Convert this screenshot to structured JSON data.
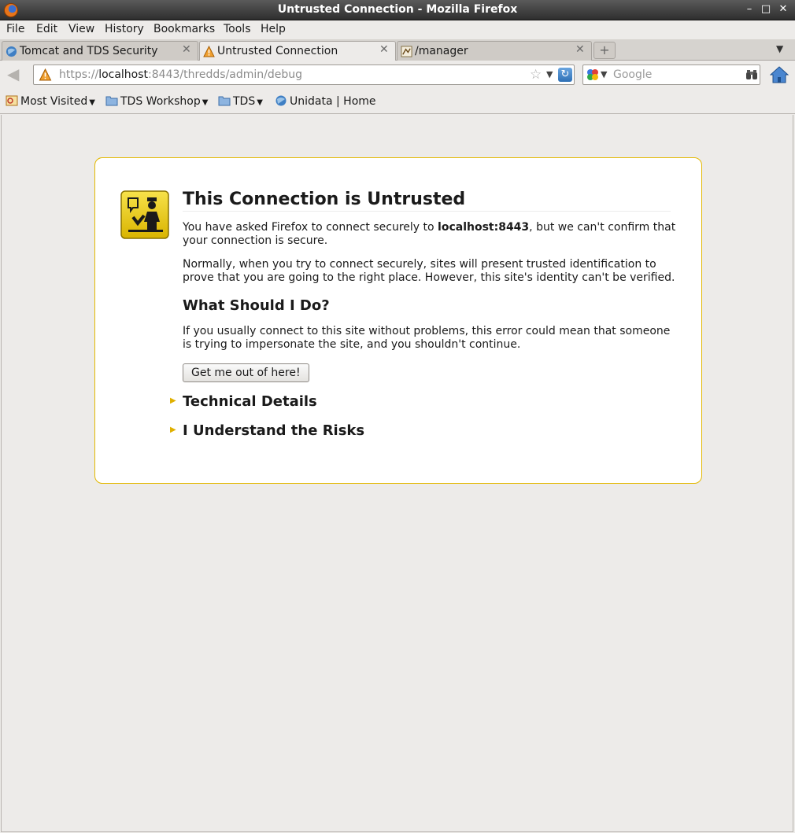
{
  "window": {
    "title": "Untrusted Connection - Mozilla Firefox"
  },
  "menu": [
    "File",
    "Edit",
    "View",
    "History",
    "Bookmarks",
    "Tools",
    "Help"
  ],
  "tabs": [
    {
      "label": "Tomcat and TDS Security"
    },
    {
      "label": "Untrusted Connection"
    },
    {
      "label": "/manager"
    }
  ],
  "navbar": {
    "url_prefix": "https://",
    "url_host": "localhost",
    "url_rest": ":8443/thredds/admin/debug",
    "search_placeholder": "Google"
  },
  "bookmarks": [
    {
      "label": "Most Visited"
    },
    {
      "label": "TDS Workshop"
    },
    {
      "label": "TDS"
    },
    {
      "label": "Unidata | Home"
    }
  ],
  "error": {
    "title": "This Connection is Untrusted",
    "p1_before": "You have asked Firefox to connect securely to ",
    "p1_host": "localhost:8443",
    "p1_after": ", but we can't confirm that your connection is secure.",
    "p2": "Normally, when you try to connect securely, sites will present trusted identification to prove that you are going to the right place. However, this site's identity can't be verified.",
    "heading": "What Should I Do?",
    "p3": "If you usually connect to this site without problems, this error could mean that someone is trying to impersonate the site, and you shouldn't continue.",
    "button": "Get me out of here!",
    "technical": "Technical Details",
    "risks": "I Understand the Risks"
  },
  "colors": {
    "accent_border": "#e3b800",
    "icon_yellow": "#f2d418"
  }
}
